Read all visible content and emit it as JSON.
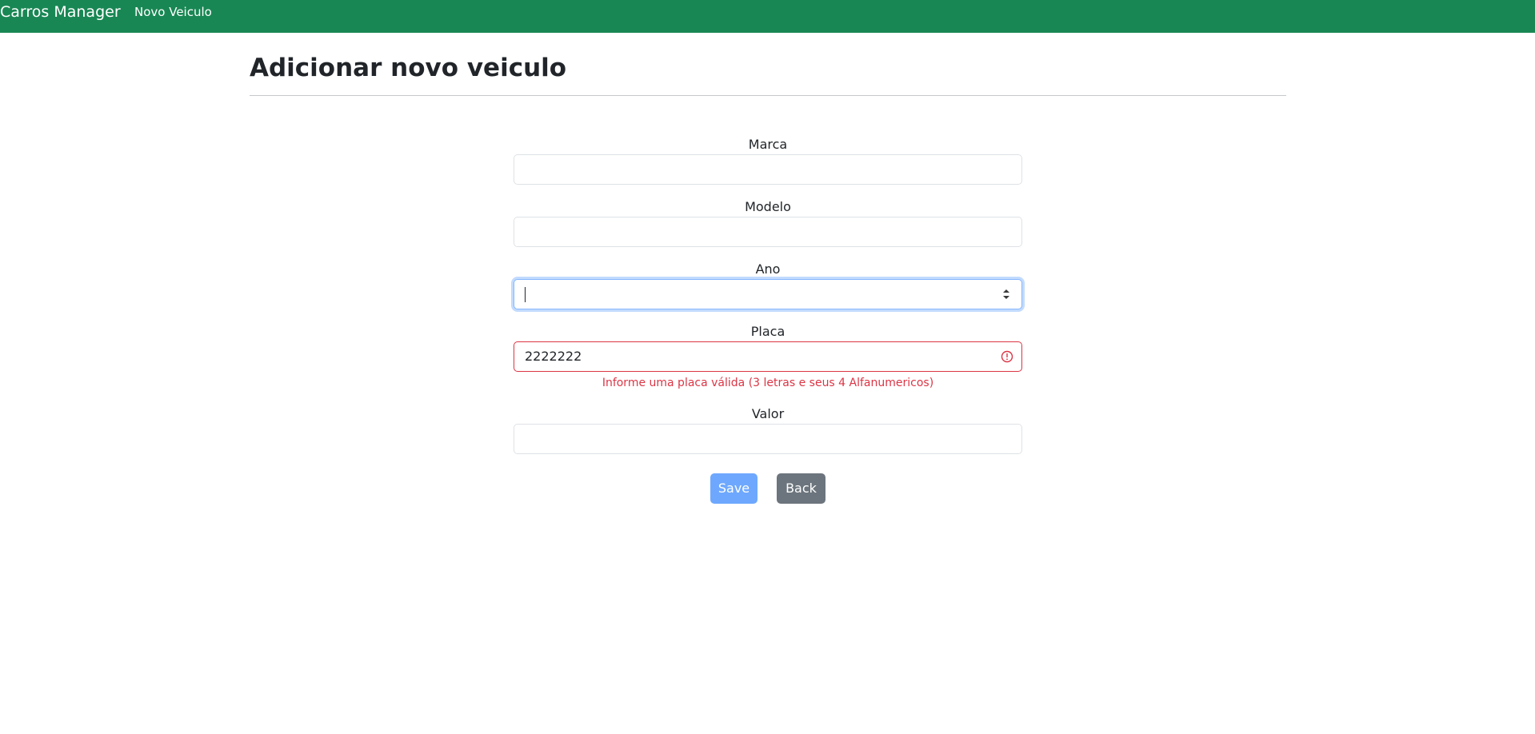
{
  "navbar": {
    "brand": "Carros Manager",
    "links": [
      {
        "label": "Novo Veiculo"
      }
    ]
  },
  "page": {
    "title": "Adicionar novo veiculo"
  },
  "form": {
    "fields": {
      "marca": {
        "label": "Marca",
        "value": ""
      },
      "modelo": {
        "label": "Modelo",
        "value": ""
      },
      "ano": {
        "label": "Ano",
        "value": "",
        "state": "focused",
        "type": "number"
      },
      "placa": {
        "label": "Placa",
        "value": "2222222",
        "state": "invalid",
        "error": "Informe uma placa válida (3 letras e seus 4 Alfanumericos)"
      },
      "valor": {
        "label": "Valor",
        "value": ""
      }
    },
    "buttons": {
      "save": "Save",
      "back": "Back"
    }
  },
  "colors": {
    "navbar": "#198754",
    "primary_disabled": "#6ea8fe",
    "secondary": "#6c757d",
    "danger": "#dc3545",
    "focus_border": "#86b7fe"
  },
  "icons": {
    "placa_status": "exclamation-circle-icon",
    "ano_spinner": "number-spinner-icon"
  }
}
